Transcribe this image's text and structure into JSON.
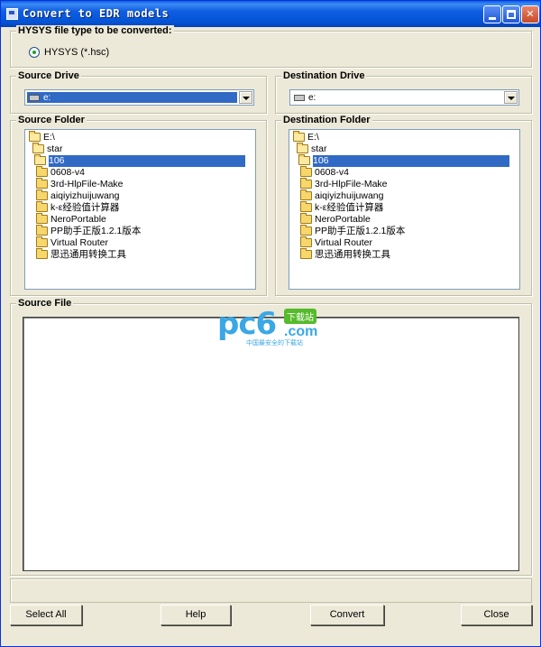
{
  "window": {
    "title": "Convert to EDR models",
    "app_icon": "app-window-icon",
    "controls": {
      "minimize_icon": "minimize-icon",
      "maximize_icon": "maximize-icon",
      "close_icon": "close-icon",
      "close_glyph": "✕"
    }
  },
  "file_type": {
    "label": "HYSYS file type to be converted:",
    "option_label": "HYSYS  (*.hsc)"
  },
  "source_drive": {
    "label": "Source Drive",
    "value": "e:"
  },
  "destination_drive": {
    "label": "Destination Drive",
    "value": "e:"
  },
  "source_folder": {
    "label": "Source Folder",
    "items": [
      "E:\\",
      "star",
      "106",
      "0608-v4",
      "3rd-HlpFile-Make",
      "aiqiyizhuijuwang",
      "k-ε经验值计算器",
      "NeroPortable",
      "PP助手正版1.2.1版本",
      "Virtual Router",
      "思迅通用转换工具"
    ]
  },
  "destination_folder": {
    "label": "Destination Folder",
    "items": [
      "E:\\",
      "star",
      "106",
      "0608-v4",
      "3rd-HlpFile-Make",
      "aiqiyizhuijuwang",
      "k-ε经验值计算器",
      "NeroPortable",
      "PP助手正版1.2.1版本",
      "Virtual Router",
      "思迅通用转换工具"
    ]
  },
  "source_file": {
    "label": "Source File"
  },
  "watermark": {
    "main": "pc6",
    "com": ".com",
    "badge": "下载站",
    "sub": "中国最安全的下载站"
  },
  "buttons": {
    "select_all": "Select All",
    "help": "Help",
    "convert": "Convert",
    "close": "Close"
  },
  "colors": {
    "selection": "#316ac5",
    "titlebar": "#0a5fe6",
    "face": "#ece9d8"
  }
}
